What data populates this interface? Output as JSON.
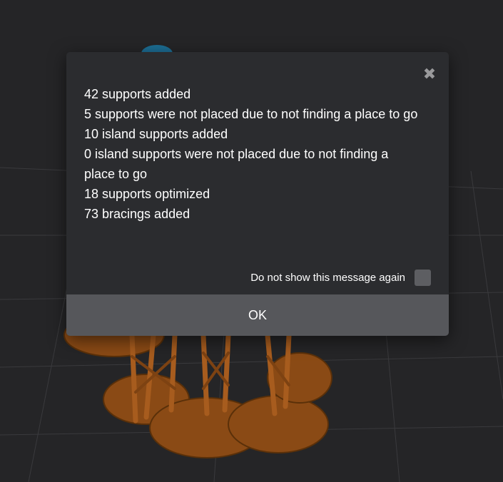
{
  "dialog": {
    "close_icon_glyph": "✖",
    "messages": [
      "42 supports added",
      "5 supports were not placed due to not finding a place to go",
      "10 island supports added",
      "0 island supports were not placed due to not finding a place to go",
      "18 supports optimized",
      "73 bracings added"
    ],
    "dont_show_label": "Do not show this message again",
    "dont_show_checked": false,
    "ok_label": "OK"
  },
  "colors": {
    "viewport_background": "#252527",
    "dialog_background": "#2b2c2f",
    "ok_button_background": "#56575b",
    "model_color": "#8a4a15"
  }
}
